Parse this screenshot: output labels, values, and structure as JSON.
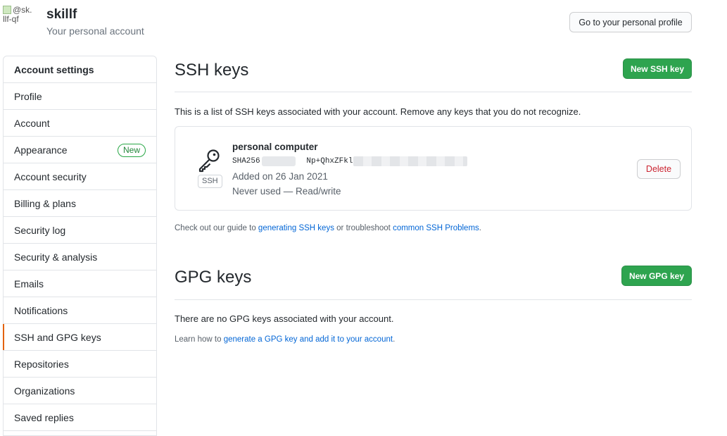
{
  "header": {
    "avatar_alt": "@sk. llf-qf",
    "username": "skillf",
    "subtitle": "Your personal account",
    "profile_button": "Go to your personal profile"
  },
  "sidebar": {
    "items": [
      {
        "label": "Account settings"
      },
      {
        "label": "Profile"
      },
      {
        "label": "Account"
      },
      {
        "label": "Appearance",
        "badge": "New"
      },
      {
        "label": "Account security"
      },
      {
        "label": "Billing & plans"
      },
      {
        "label": "Security log"
      },
      {
        "label": "Security & analysis"
      },
      {
        "label": "Emails"
      },
      {
        "label": "Notifications"
      },
      {
        "label": "SSH and GPG keys"
      },
      {
        "label": "Repositories"
      },
      {
        "label": "Organizations"
      },
      {
        "label": "Saved replies"
      }
    ]
  },
  "ssh": {
    "title": "SSH keys",
    "new_button": "New SSH key",
    "description": "This is a list of SSH keys associated with your account. Remove any keys that you do not recognize.",
    "key": {
      "tag": "SSH",
      "title": "personal computer",
      "fingerprint_start": "SHA256:J7",
      "fingerprint_mid": "Np+QhxZFklq6",
      "added": "Added on 26 Jan 2021",
      "used": "Never used — Read/write",
      "delete_button": "Delete"
    },
    "note_prefix": "Check out our guide to ",
    "note_link1": "generating SSH keys",
    "note_middle": " or troubleshoot ",
    "note_link2": "common SSH Problems",
    "note_suffix": "."
  },
  "gpg": {
    "title": "GPG keys",
    "new_button": "New GPG key",
    "empty_text": "There are no GPG keys associated with your account.",
    "note_prefix": "Learn how to ",
    "note_link": "generate a GPG key and add it to your account",
    "note_suffix": "."
  },
  "colors": {
    "primary_green": "#2ea44f",
    "link_blue": "#0366d6",
    "danger_red": "#cb2431",
    "selected_indicator": "#e36209"
  }
}
